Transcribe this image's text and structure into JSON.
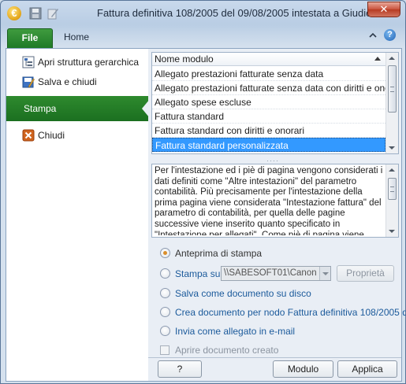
{
  "app": {
    "icon_glyph": "€",
    "title": "Fattura definitiva 108/2005 del 09/08/2005 intestata a Giudic...",
    "close_glyph": "✕"
  },
  "ribbon": {
    "tabs": [
      {
        "label": "File",
        "active": true
      },
      {
        "label": "Home",
        "active": false
      }
    ],
    "help_glyph": "?"
  },
  "menu": {
    "items": [
      {
        "label": "Apri struttura gerarchica",
        "icon": "tree-structure-icon"
      },
      {
        "label": "Salva e chiudi",
        "icon": "save-close-icon"
      },
      {
        "label": "Stampa",
        "icon": null,
        "active": true
      },
      {
        "label": "Chiudi",
        "icon": "close-document-icon"
      }
    ]
  },
  "modules": {
    "header": "Nome modulo",
    "rows": [
      "Allegato prestazioni fatturate senza data",
      "Allegato prestazioni fatturate senza data con diritti e onorari",
      "Allegato spese escluse",
      "Fattura standard",
      "Fattura standard con diritti e onorari",
      "Fattura standard personalizzata"
    ],
    "selected_index": 5
  },
  "splitter_glyph": "····",
  "description": "Per l'intestazione ed i piè di pagina vengono considerati i dati definiti come \"Altre intestazioni\" del parametro contabilità. Più precisamente per l'intestazione della prima pagina viene considerata \"Intestazione fattura\" del parametro di contabilità, per quella delle pagine successive viene inserito quanto specificato in \"Intestazione per allegati\". Come piè di pagina viene considerato quanto è indicato in \"Pie di pagina",
  "options": {
    "preview": "Anteprima di stampa",
    "print_on": "Stampa su",
    "printer": "\\\\SABESOFT01\\Canon",
    "properties": "Proprietà",
    "save_disk": "Salva come documento su disco",
    "create_doc": "Crea documento per nodo Fattura definitiva 108/2005 del",
    "send_email": "Invia come allegato in e-mail",
    "open_created": "Aprire documento creato",
    "selected": "preview"
  },
  "buttons": {
    "help": "?",
    "module": "Modulo",
    "apply": "Applica"
  },
  "colors": {
    "accent_green": "#1f7a26",
    "selection_blue": "#3399ff",
    "close_red": "#c9513b"
  }
}
